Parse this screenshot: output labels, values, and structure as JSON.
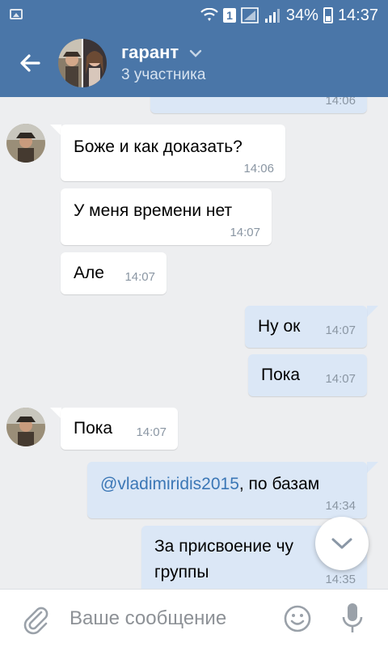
{
  "status_bar": {
    "sim": "1",
    "battery": "34%",
    "time": "14:37"
  },
  "header": {
    "title": "гарант",
    "subtitle": "3 участника"
  },
  "messages": [
    {
      "dir": "out",
      "text": "",
      "time": "14:06"
    },
    {
      "dir": "in",
      "text": "Боже и как доказать?",
      "time": "14:06"
    },
    {
      "dir": "in",
      "text": "У меня времени нет",
      "time": "14:07"
    },
    {
      "dir": "in",
      "text": "Але",
      "time": "14:07"
    },
    {
      "dir": "out",
      "text": "Ну ок",
      "time": "14:07"
    },
    {
      "dir": "out",
      "text": "Пока",
      "time": "14:07"
    },
    {
      "dir": "in",
      "text": "Пока",
      "time": "14:07"
    },
    {
      "dir": "out",
      "mention": "@vladimiridis2015",
      "text": ", по базам",
      "time": "14:34"
    },
    {
      "dir": "out",
      "text_line1": "За присвоение чу",
      "text_line2": "группы",
      "time": "14:35"
    }
  ],
  "composer": {
    "placeholder": "Ваше сообщение"
  },
  "icons": {
    "back": "back-arrow-icon",
    "attach": "paperclip-icon",
    "emoji": "smiley-icon",
    "mic": "microphone-icon",
    "scroll_down": "chevron-down-icon"
  },
  "colors": {
    "header": "#4a76a8",
    "background": "#edeef0",
    "incoming_bubble": "#ffffff",
    "outgoing_bubble": "#dbe7f6",
    "mention": "#3b77b6"
  }
}
